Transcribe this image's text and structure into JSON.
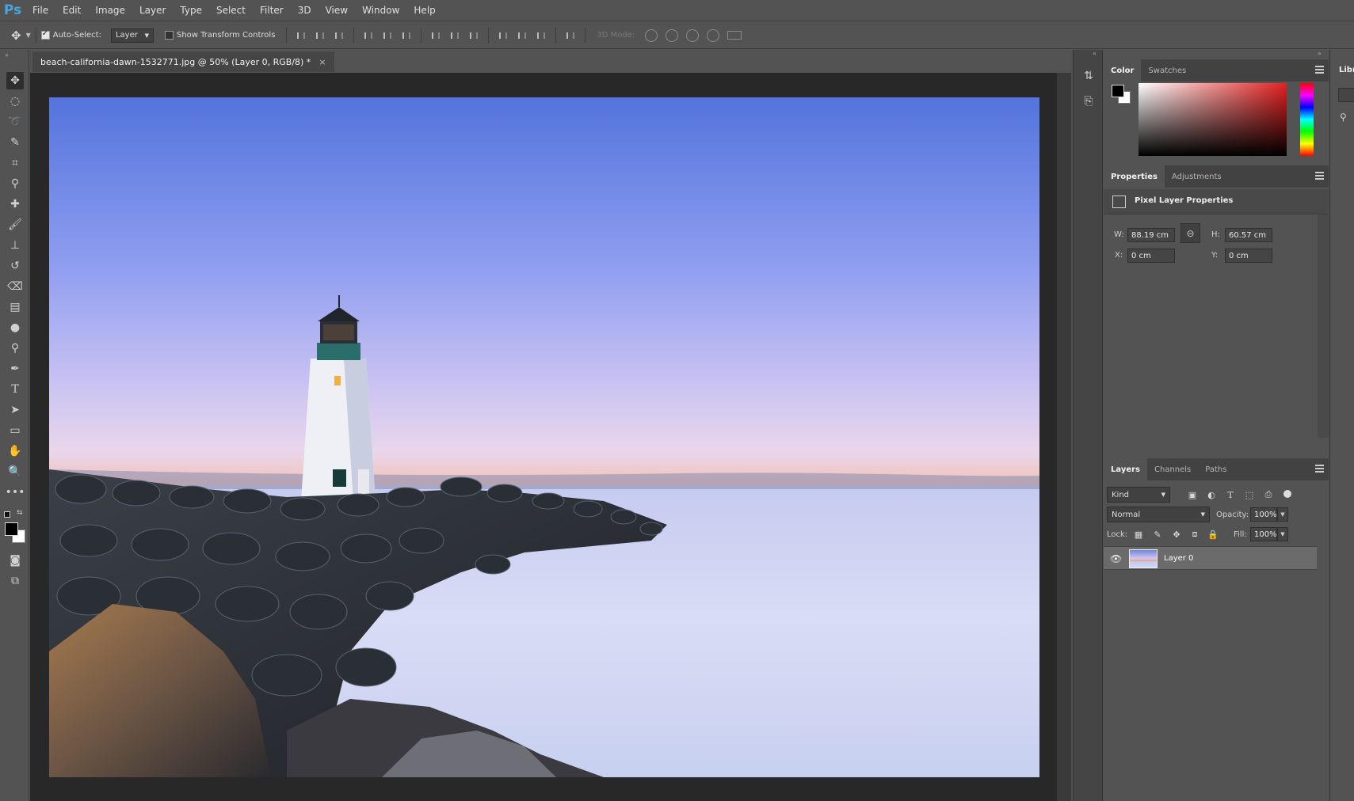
{
  "app": {
    "logo": "Ps"
  },
  "menu": [
    "File",
    "Edit",
    "Image",
    "Layer",
    "Type",
    "Select",
    "Filter",
    "3D",
    "View",
    "Window",
    "Help"
  ],
  "options": {
    "auto_select_label": "Auto-Select:",
    "auto_select_target": "Layer",
    "show_transform_label": "Show Transform Controls",
    "threed_mode_label": "3D Mode:"
  },
  "document": {
    "tab_title": "beach-california-dawn-1532771.jpg @ 50% (Layer 0, RGB/8) *",
    "close": "×"
  },
  "color_panel": {
    "tabs": [
      "Color",
      "Swatches"
    ],
    "foreground": "#000000",
    "background": "#ffffff"
  },
  "properties_panel": {
    "tabs": [
      "Properties",
      "Adjustments"
    ],
    "header": "Pixel Layer Properties",
    "w_label": "W:",
    "w_value": "88.19 cm",
    "h_label": "H:",
    "h_value": "60.57 cm",
    "x_label": "X:",
    "x_value": "0 cm",
    "y_label": "Y:",
    "y_value": "0 cm"
  },
  "layers_panel": {
    "tabs": [
      "Layers",
      "Channels",
      "Paths"
    ],
    "filter_kind": "Kind",
    "blend_mode": "Normal",
    "opacity_label": "Opacity:",
    "opacity_value": "100%",
    "lock_label": "Lock:",
    "fill_label": "Fill:",
    "fill_value": "100%",
    "layers": [
      {
        "name": "Layer 0",
        "visible": true
      }
    ]
  },
  "libraries": {
    "tab": "Libra"
  }
}
